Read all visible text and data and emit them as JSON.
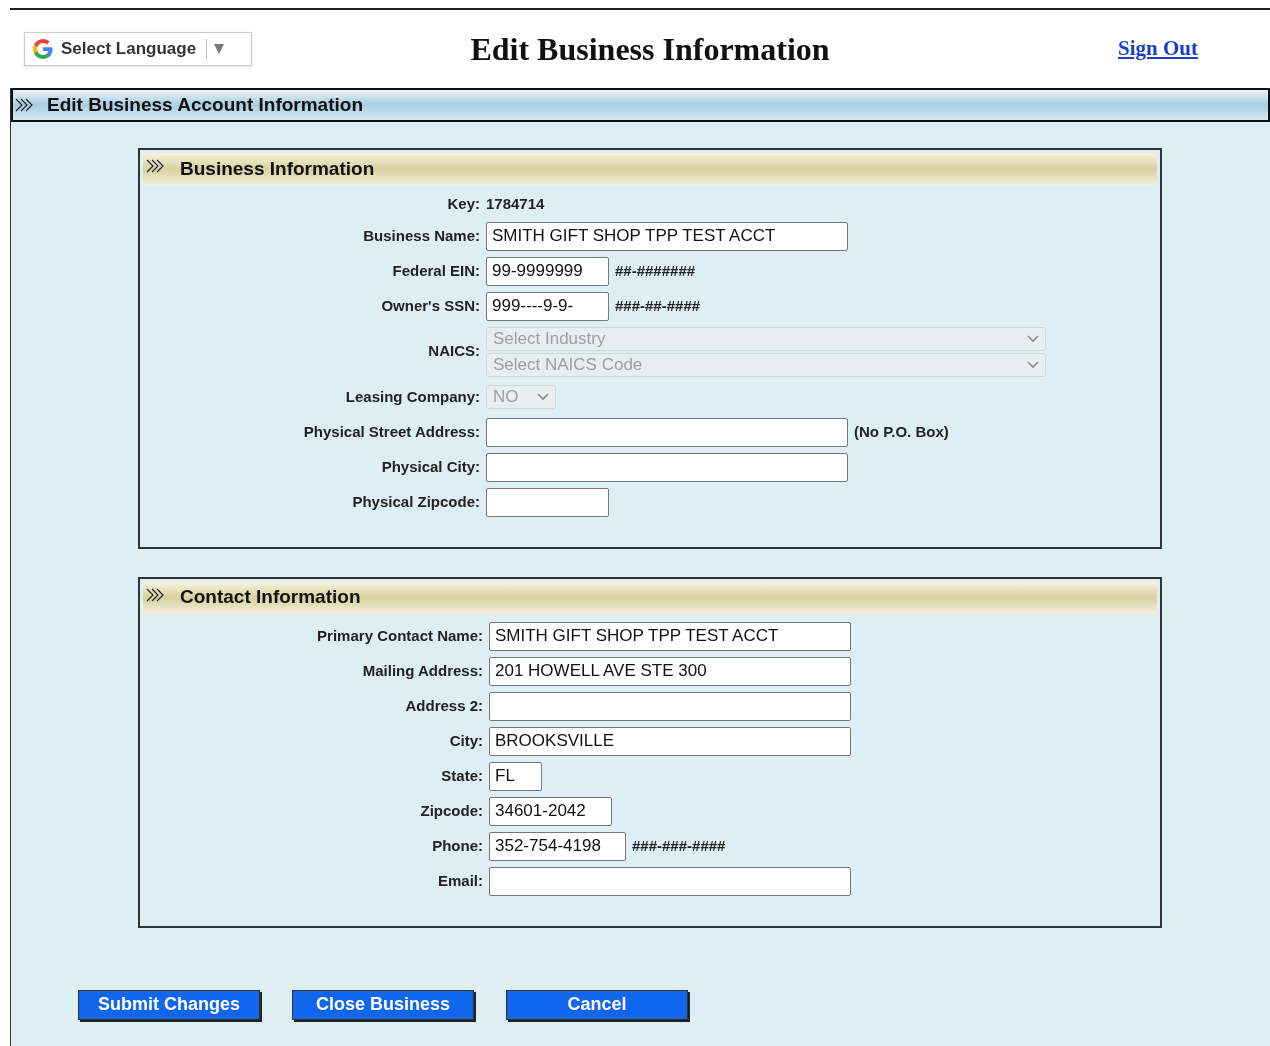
{
  "header": {
    "language_selector": "Select Language",
    "title": "Edit Business Information",
    "sign_out": "Sign Out"
  },
  "panel": {
    "title": "Edit Business Account Information"
  },
  "sections": [
    {
      "title": "Business Information",
      "rows": [
        {
          "kind": "static",
          "label": "Key:",
          "value": "1784714"
        },
        {
          "kind": "wide",
          "label": "Business Name:",
          "value": "SMITH GIFT SHOP TPP TEST ACCT"
        },
        {
          "kind": "short",
          "label": "Federal EIN:",
          "value": "99-9999999",
          "hint": "##-#######"
        },
        {
          "kind": "short",
          "label": "Owner's SSN:",
          "value": "999----9-9-",
          "hint": "###-##-####"
        },
        {
          "kind": "selects",
          "label": "NAICS:",
          "selects": [
            {
              "value": "Select Industry",
              "disabled": true
            },
            {
              "value": "Select NAICS Code",
              "disabled": true
            }
          ]
        },
        {
          "kind": "select",
          "label": "Leasing Company:",
          "value": "NO",
          "disabled": true
        },
        {
          "kind": "wide",
          "label": "Physical Street Address:",
          "hint": "(No P.O. Box)"
        },
        {
          "kind": "wide",
          "label": "Physical City:"
        },
        {
          "kind": "short",
          "label": "Physical Zipcode:"
        }
      ]
    },
    {
      "title": "Contact Information",
      "rows": [
        {
          "kind": "wide",
          "label": "Primary Contact Name:",
          "value": "SMITH GIFT SHOP TPP TEST ACCT"
        },
        {
          "kind": "wide",
          "label": "Mailing Address:",
          "value": "201 HOWELL AVE STE 300"
        },
        {
          "kind": "wide",
          "label": "Address 2:"
        },
        {
          "kind": "wide",
          "label": "City:",
          "value": "BROOKSVILLE"
        },
        {
          "kind": "tiny",
          "label": "State:",
          "value": "FL"
        },
        {
          "kind": "short",
          "label": "Zipcode:",
          "value": "34601-2042"
        },
        {
          "kind": "medium",
          "label": "Phone:",
          "value": "352-754-4198",
          "hint": "###-###-####"
        },
        {
          "kind": "wide",
          "label": "Email:"
        }
      ]
    }
  ],
  "buttons": [
    "Submit Changes",
    "Close Business",
    "Cancel"
  ]
}
